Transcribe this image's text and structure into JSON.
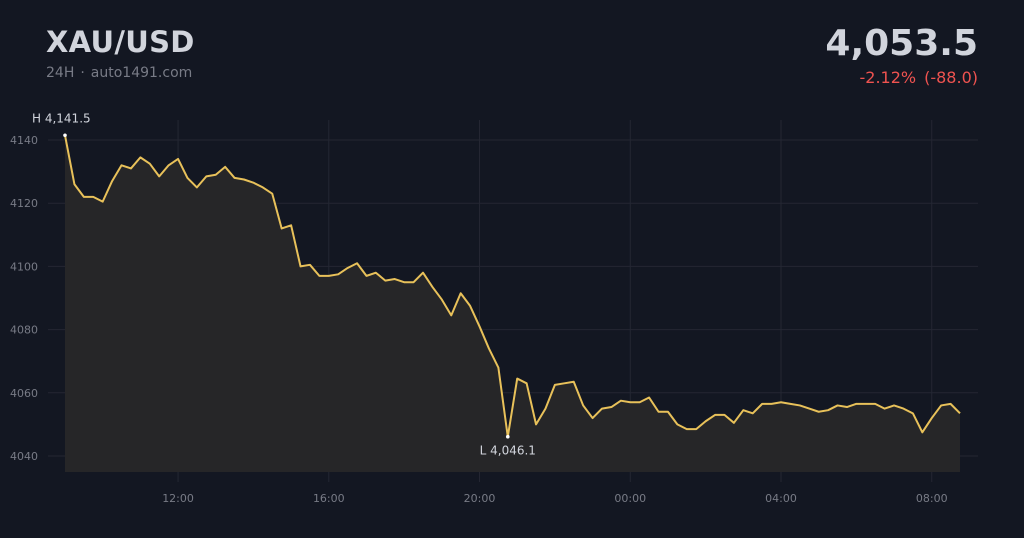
{
  "header": {
    "symbol": "XAU/USD",
    "period": "24H",
    "separator": "·",
    "source": "auto1491.com",
    "price": "4,053.5",
    "change_percent": "-2.12%",
    "change_abs": "(-88.0)"
  },
  "colors": {
    "background": "#131722",
    "line": "#e8c15a",
    "area_fill": "#262628",
    "grid": "#242733",
    "text_primary": "#d1d4dc",
    "text_muted": "#787b86",
    "negative": "#ef5350"
  },
  "chart_data": {
    "type": "area",
    "x_start": "09:00",
    "x_interval_minutes": 15,
    "values": [
      4141.5,
      4126,
      4122,
      4122,
      4120.5,
      4127,
      4132,
      4131,
      4134.5,
      4132.5,
      4128.5,
      4132,
      4134,
      4128,
      4125,
      4128.5,
      4129,
      4131.5,
      4128,
      4127.5,
      4126.5,
      4125,
      4123,
      4112,
      4113,
      4100,
      4100.5,
      4097,
      4097,
      4097.5,
      4099.5,
      4101,
      4097,
      4098,
      4095.5,
      4096,
      4095,
      4095,
      4098,
      4093.5,
      4089.5,
      4084.5,
      4091.5,
      4087.5,
      4081,
      4074,
      4068,
      4046.1,
      4064.5,
      4063,
      4050,
      4055,
      4062.5,
      4063,
      4063.5,
      4056,
      4052,
      4055,
      4055.5,
      4057.5,
      4057,
      4057,
      4058.5,
      4054,
      4054,
      4050,
      4048.5,
      4048.5,
      4051,
      4053,
      4053,
      4050.5,
      4054.5,
      4053.5,
      4056.5,
      4056.5,
      4057,
      4056.5,
      4056,
      4055,
      4054,
      4054.5,
      4056,
      4055.5,
      4056.5,
      4056.5,
      4056.5,
      4055,
      4056,
      4055,
      4053.5,
      4047.5,
      4052,
      4056,
      4056.5,
      4053.5
    ],
    "x_ticks": [
      "12:00",
      "16:00",
      "20:00",
      "00:00",
      "04:00",
      "08:00"
    ],
    "y_ticks": [
      4040,
      4060,
      4080,
      4100,
      4120,
      4140
    ],
    "ylim": [
      4035,
      4145
    ],
    "high": {
      "index": 0,
      "value": 4141.5,
      "label": "H 4,141.5"
    },
    "low": {
      "index": 47,
      "value": 4046.1,
      "label": "L 4,046.1"
    },
    "grid": true,
    "legend": "none"
  }
}
